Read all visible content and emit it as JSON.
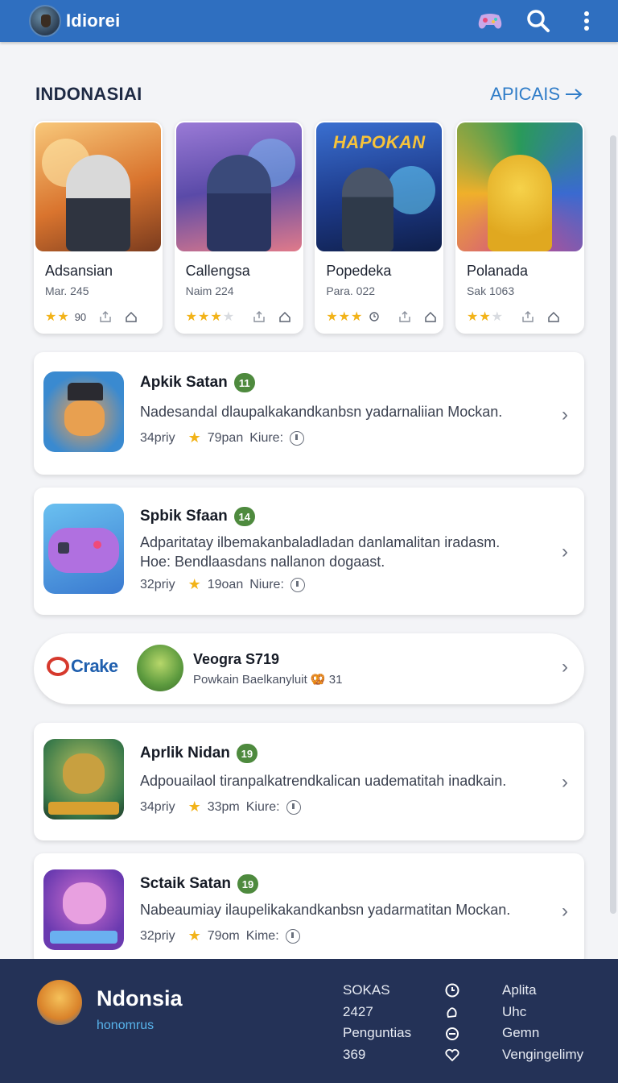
{
  "app": {
    "title": "Idiorei"
  },
  "header": {
    "icons": [
      "gamepad-icon",
      "search-icon",
      "more-vertical-icon"
    ]
  },
  "section": {
    "title": "INDONASIAI",
    "link": "APICAIS"
  },
  "featured": [
    {
      "name": "Adsansian",
      "sub": "Mar. 245",
      "rating": 2,
      "count": "90"
    },
    {
      "name": "Callengsa",
      "sub": "Naim 224",
      "rating": 3,
      "count": ""
    },
    {
      "name": "Popedeka",
      "sub": "Para. 022",
      "rating": 3,
      "count": ""
    },
    {
      "name": "Polanada",
      "sub": "Sak 1063",
      "rating": 2,
      "count": ""
    }
  ],
  "featured_art_text": [
    "HAPOKAN"
  ],
  "apps": [
    {
      "title": "Apkik Satan",
      "badge": "11",
      "desc": [
        "Nadesandal dlaupalkakandkanbsn yadarnaliian Mockan."
      ],
      "size": "34priy",
      "score": "79pan",
      "label": "Kiure:"
    },
    {
      "title": "Spbik Sfaan",
      "badge": "14",
      "desc": [
        "Adparitatay ilbemakanbaladladan danlamalitan iradasm.",
        "Hoe: Bendlaasdans nallanon dogaast."
      ],
      "size": "32priy",
      "score": "19oan",
      "label": "Niure:"
    },
    {
      "title": "Aprlik Nidan",
      "badge": "19",
      "desc": [
        "Adpouailaol tiranpalkatrendkalican uadematitah inadkain."
      ],
      "size": "34priy",
      "score": "33pm",
      "label": "Kiure:"
    },
    {
      "title": "Sctaik Satan",
      "badge": "19",
      "desc": [
        "Nabeaumiay ilaupelikakandkanbsn yadarmatitan Mockan."
      ],
      "size": "32priy",
      "score": "79om",
      "label": "Kime:"
    }
  ],
  "promo": {
    "brand": "Crake",
    "title": "Veogra S719",
    "subtitle": "Powkain Baelkanyluit 🥨 31"
  },
  "footer": {
    "name": "Ndonsia",
    "subtitle": "honomrus",
    "stats": [
      "SOKAS",
      "2427",
      "Penguntias",
      "369"
    ],
    "links": [
      "Aplita",
      "Uhc",
      "Gemn",
      "Vengingelimy"
    ]
  },
  "colors": {
    "topbar": "#2f6fc0",
    "accent": "#2f7cc8",
    "badge": "#4e8a3e",
    "star": "#f2b319",
    "footer": "#243257"
  }
}
